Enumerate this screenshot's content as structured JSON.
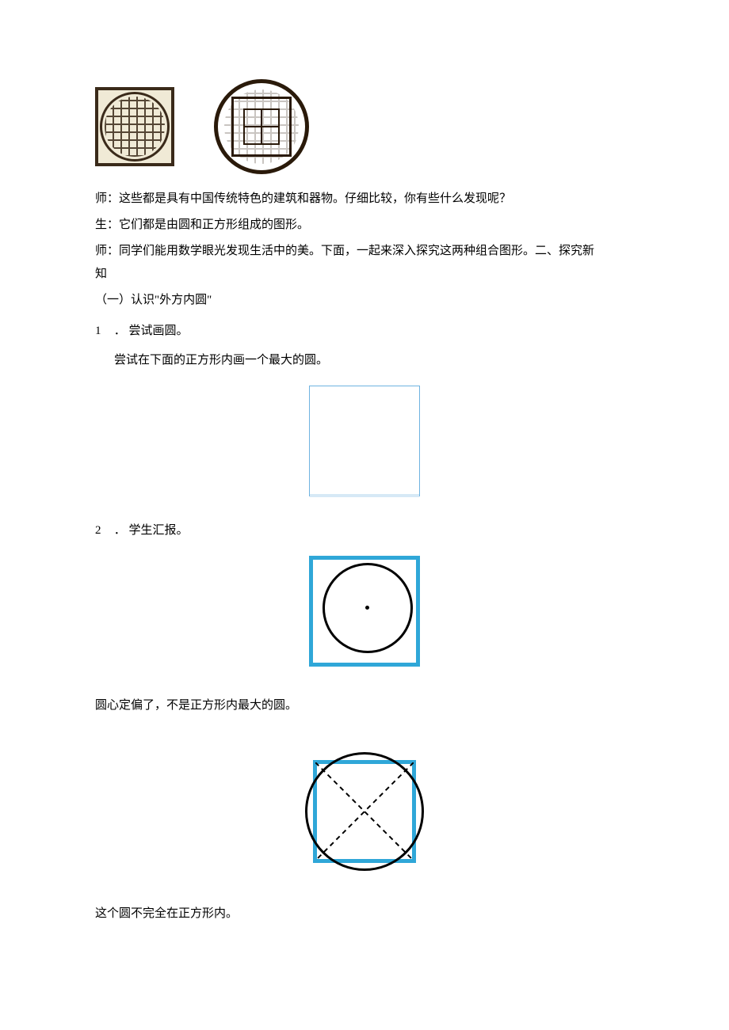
{
  "intro": {
    "teacher_line1": "师：这些都是具有中国传统特色的建筑和器物。仔细比较，你有些什么发现呢？",
    "student_line": "生：它们都是由圆和正方形组成的图形。",
    "teacher_line2_a": "师：同学们能用数学眼光发现生活中的美。下面，一起来深入探究这两种组合图形。二、探究新",
    "teacher_line2_b": "知"
  },
  "section": {
    "heading": "（一）认识\"外方内圆\"",
    "item1": {
      "num": "1",
      "sep": "．",
      "title": "尝试画圆。",
      "desc": "尝试在下面的正方形内画一个最大的圆。"
    },
    "item2": {
      "num": "2",
      "sep": "．",
      "title": "学生汇报。"
    },
    "note1": "圆心定偏了，不是正方形内最大的圆。",
    "note2": "这个圆不完全在正方形内。"
  },
  "icons": {
    "lattice_square": "decorative-lattice-square",
    "lattice_circle": "decorative-lattice-circle"
  }
}
